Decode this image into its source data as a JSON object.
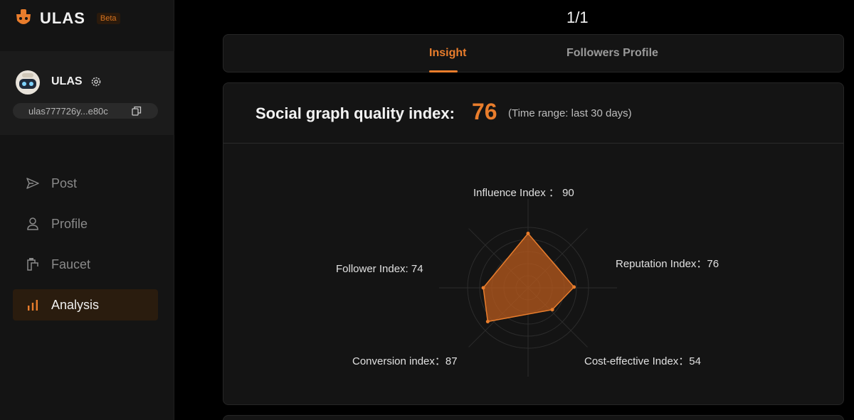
{
  "brand": {
    "name": "ULAS",
    "badge": "Beta"
  },
  "account": {
    "name": "ULAS",
    "wallet": "ulas777726y...e80c"
  },
  "nav": [
    {
      "label": "Post",
      "icon": "send-icon"
    },
    {
      "label": "Profile",
      "icon": "user-icon"
    },
    {
      "label": "Faucet",
      "icon": "faucet-icon"
    },
    {
      "label": "Analysis",
      "icon": "bar-chart-icon",
      "active": true
    }
  ],
  "pager": "1/1",
  "tabs": {
    "insight": "Insight",
    "followers": "Followers Profile",
    "active": "Insight"
  },
  "panel": {
    "label": "Social graph quality index:",
    "score": "76",
    "range": "(Time range: last 30 days)"
  },
  "colors": {
    "accent": "#e97d2c",
    "background": "#000000",
    "panel": "#141414"
  },
  "chart_data": {
    "type": "radar",
    "max": 100,
    "axes": [
      {
        "key": "influence",
        "label": "Influence Index ： 90",
        "value": 90
      },
      {
        "key": "reputation",
        "label": "Reputation Index：76",
        "value": 76
      },
      {
        "key": "cost",
        "label": "Cost-effective Index：54",
        "value": 54
      },
      {
        "key": "conversion",
        "label": "Conversion index：87",
        "value": 87
      },
      {
        "key": "follower",
        "label": "Follower Index: 74",
        "value": 74
      }
    ]
  }
}
